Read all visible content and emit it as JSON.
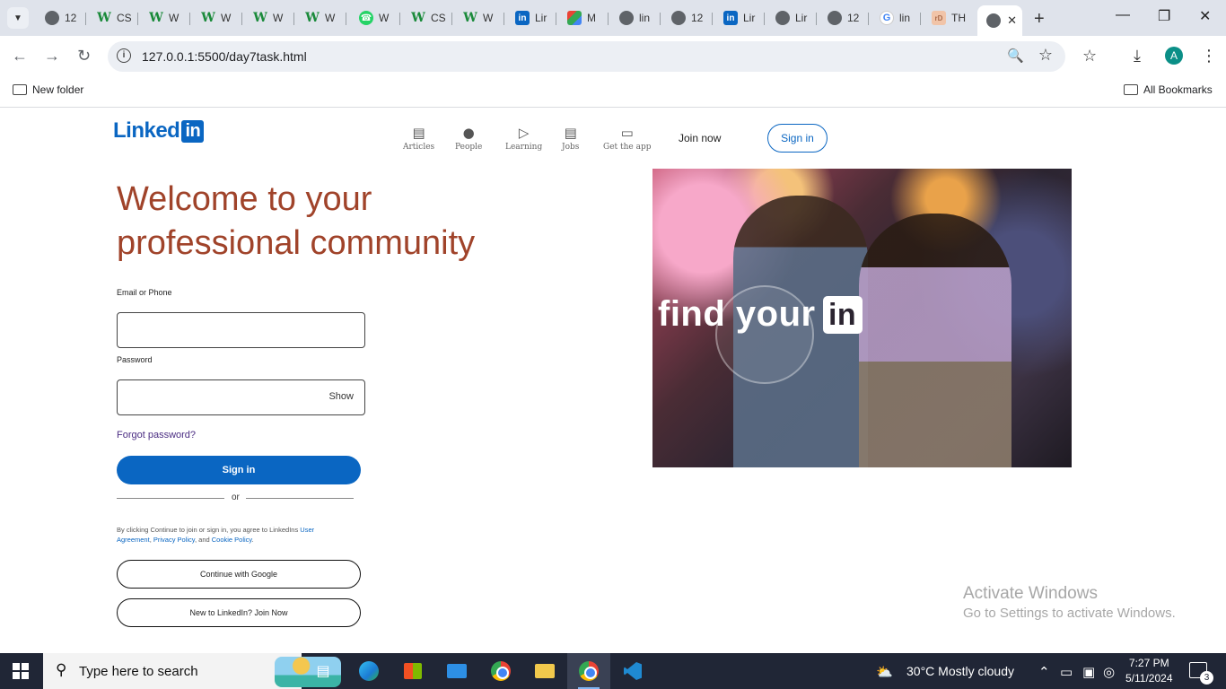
{
  "browser": {
    "tabs": [
      {
        "label": "12",
        "icon": "globe-icon"
      },
      {
        "label": "CS",
        "icon": "w-icon"
      },
      {
        "label": "W",
        "icon": "w-icon"
      },
      {
        "label": "W",
        "icon": "w-icon"
      },
      {
        "label": "W",
        "icon": "w-icon"
      },
      {
        "label": "W",
        "icon": "w-icon"
      },
      {
        "label": "W",
        "icon": "whatsapp-icon"
      },
      {
        "label": "CS",
        "icon": "w-icon"
      },
      {
        "label": "W",
        "icon": "w-icon"
      },
      {
        "label": "Lir",
        "icon": "linkedin-icon"
      },
      {
        "label": "M",
        "icon": "m-icon"
      },
      {
        "label": "lin",
        "icon": "globe-icon"
      },
      {
        "label": "12",
        "icon": "globe-icon"
      },
      {
        "label": "Lir",
        "icon": "linkedin-icon"
      },
      {
        "label": "Lir",
        "icon": "globe-icon"
      },
      {
        "label": "12",
        "icon": "globe-icon"
      },
      {
        "label": "lin",
        "icon": "google-icon"
      },
      {
        "label": "TH",
        "icon": "th-icon"
      }
    ],
    "url": "127.0.0.1:5500/day7task.html",
    "avatar_initial": "A",
    "bookmarks": {
      "folder": "New folder",
      "all": "All Bookmarks"
    }
  },
  "page": {
    "logo_text": "Linked",
    "logo_in": "in",
    "nav": [
      {
        "label": "Articles",
        "icon": "articles-icon"
      },
      {
        "label": "People",
        "icon": "people-icon"
      },
      {
        "label": "Learning",
        "icon": "learning-icon"
      },
      {
        "label": "Jobs",
        "icon": "jobs-icon"
      },
      {
        "label": "Get the app",
        "icon": "laptop-icon"
      }
    ],
    "join_now": "Join now",
    "sign_in_top": "Sign in",
    "headline": "Welcome to your professional community",
    "email_label": "Email or Phone",
    "password_label": "Password",
    "show": "Show",
    "forgot": "Forgot password?",
    "sign_in_btn": "Sign in",
    "or": "or",
    "legal_pre": "By clicking Continue to join or sign in, you agree to LinkedIns ",
    "legal_ua": "User Agreement",
    "legal_sep": ", ",
    "legal_pp": "Privacy Policy",
    "legal_and": ", and ",
    "legal_cp": "Cookie Policy",
    "legal_end": ".",
    "google_btn": "Continue with Google",
    "join_btn": "New to LinkedIn? Join Now",
    "hero_text": "find your",
    "hero_in": "in"
  },
  "watermark": {
    "line1": "Activate Windows",
    "line2": "Go to Settings to activate Windows."
  },
  "taskbar": {
    "search_placeholder": "Type here to search",
    "weather": "30°C  Mostly cloudy",
    "time": "7:27 PM",
    "date": "5/11/2024",
    "notifications": "3"
  },
  "colors": {
    "brand": "#0a66c2",
    "headline": "#a0432a"
  }
}
